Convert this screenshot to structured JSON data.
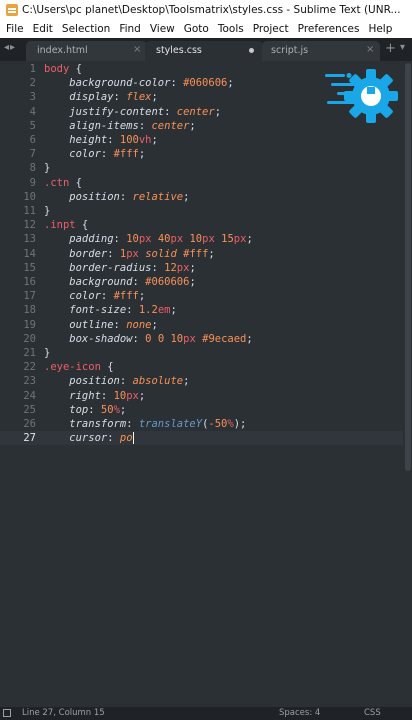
{
  "window": {
    "title": "C:\\Users\\pc planet\\Desktop\\Toolsmatrix\\styles.css - Sublime Text (UNR..."
  },
  "menu": [
    "File",
    "Edit",
    "Selection",
    "Find",
    "View",
    "Goto",
    "Tools",
    "Project",
    "Preferences",
    "Help"
  ],
  "tabs": [
    {
      "label": "index.html",
      "active": false
    },
    {
      "label": "styles.css",
      "active": true,
      "modified": true
    },
    {
      "label": "script.js",
      "active": false
    }
  ],
  "tab_nav_icons": [
    "chevron-left-icon",
    "chevron-right-icon"
  ],
  "editor": {
    "current_line": 27,
    "lines": [
      [
        [
          "body",
          "t-sel"
        ],
        [
          " {",
          "t-punc"
        ]
      ],
      [
        [
          "    background-color",
          "t-prop"
        ],
        [
          ": ",
          "t-punc"
        ],
        [
          "#060606",
          "t-val"
        ],
        [
          ";",
          "t-punc"
        ]
      ],
      [
        [
          "    display",
          "t-prop"
        ],
        [
          ": ",
          "t-punc"
        ],
        [
          "flex",
          "t-kw"
        ],
        [
          ";",
          "t-punc"
        ]
      ],
      [
        [
          "    justify-content",
          "t-prop"
        ],
        [
          ": ",
          "t-punc"
        ],
        [
          "center",
          "t-kw"
        ],
        [
          ";",
          "t-punc"
        ]
      ],
      [
        [
          "    align-items",
          "t-prop"
        ],
        [
          ": ",
          "t-punc"
        ],
        [
          "center",
          "t-kw"
        ],
        [
          ";",
          "t-punc"
        ]
      ],
      [
        [
          "    height",
          "t-prop"
        ],
        [
          ": ",
          "t-punc"
        ],
        [
          "100",
          "t-val"
        ],
        [
          "vh",
          "t-unit"
        ],
        [
          ";",
          "t-punc"
        ]
      ],
      [
        [
          "    color",
          "t-prop"
        ],
        [
          ": ",
          "t-punc"
        ],
        [
          "#fff",
          "t-val"
        ],
        [
          ";",
          "t-punc"
        ]
      ],
      [
        [
          "}",
          "t-punc"
        ]
      ],
      [
        [
          ".ctn",
          "t-sel"
        ],
        [
          " {",
          "t-punc"
        ]
      ],
      [
        [
          "    position",
          "t-prop"
        ],
        [
          ": ",
          "t-punc"
        ],
        [
          "relative",
          "t-kw"
        ],
        [
          ";",
          "t-punc"
        ]
      ],
      [
        [
          "}",
          "t-punc"
        ]
      ],
      [
        [
          ".inpt",
          "t-sel"
        ],
        [
          " {",
          "t-punc"
        ]
      ],
      [
        [
          "    padding",
          "t-prop"
        ],
        [
          ": ",
          "t-punc"
        ],
        [
          "10",
          "t-val"
        ],
        [
          "px",
          "t-unit"
        ],
        [
          " ",
          "t-text"
        ],
        [
          "40",
          "t-val"
        ],
        [
          "px",
          "t-unit"
        ],
        [
          " ",
          "t-text"
        ],
        [
          "10",
          "t-val"
        ],
        [
          "px",
          "t-unit"
        ],
        [
          " ",
          "t-text"
        ],
        [
          "15",
          "t-val"
        ],
        [
          "px",
          "t-unit"
        ],
        [
          ";",
          "t-punc"
        ]
      ],
      [
        [
          "    border",
          "t-prop"
        ],
        [
          ": ",
          "t-punc"
        ],
        [
          "1",
          "t-val"
        ],
        [
          "px",
          "t-unit"
        ],
        [
          " ",
          "t-text"
        ],
        [
          "solid",
          "t-kw"
        ],
        [
          " ",
          "t-text"
        ],
        [
          "#fff",
          "t-val"
        ],
        [
          ";",
          "t-punc"
        ]
      ],
      [
        [
          "    border-radius",
          "t-prop"
        ],
        [
          ": ",
          "t-punc"
        ],
        [
          "12",
          "t-val"
        ],
        [
          "px",
          "t-unit"
        ],
        [
          ";",
          "t-punc"
        ]
      ],
      [
        [
          "    background",
          "t-prop"
        ],
        [
          ": ",
          "t-punc"
        ],
        [
          "#060606",
          "t-val"
        ],
        [
          ";",
          "t-punc"
        ]
      ],
      [
        [
          "    color",
          "t-prop"
        ],
        [
          ": ",
          "t-punc"
        ],
        [
          "#fff",
          "t-val"
        ],
        [
          ";",
          "t-punc"
        ]
      ],
      [
        [
          "    font-size",
          "t-prop"
        ],
        [
          ": ",
          "t-punc"
        ],
        [
          "1.2",
          "t-val"
        ],
        [
          "em",
          "t-unit"
        ],
        [
          ";",
          "t-punc"
        ]
      ],
      [
        [
          "    outline",
          "t-prop"
        ],
        [
          ": ",
          "t-punc"
        ],
        [
          "none",
          "t-kw"
        ],
        [
          ";",
          "t-punc"
        ]
      ],
      [
        [
          "    box-shadow",
          "t-prop"
        ],
        [
          ": ",
          "t-punc"
        ],
        [
          "0",
          "t-val"
        ],
        [
          " ",
          "t-text"
        ],
        [
          "0",
          "t-val"
        ],
        [
          " ",
          "t-text"
        ],
        [
          "10",
          "t-val"
        ],
        [
          "px",
          "t-unit"
        ],
        [
          " ",
          "t-text"
        ],
        [
          "#9ecaed",
          "t-val"
        ],
        [
          ";",
          "t-punc"
        ]
      ],
      [
        [
          "}",
          "t-punc"
        ]
      ],
      [
        [
          ".eye-icon",
          "t-sel"
        ],
        [
          " {",
          "t-punc"
        ]
      ],
      [
        [
          "    position",
          "t-prop"
        ],
        [
          ": ",
          "t-punc"
        ],
        [
          "absolute",
          "t-kw"
        ],
        [
          ";",
          "t-punc"
        ]
      ],
      [
        [
          "    right",
          "t-prop"
        ],
        [
          ": ",
          "t-punc"
        ],
        [
          "10",
          "t-val"
        ],
        [
          "px",
          "t-unit"
        ],
        [
          ";",
          "t-punc"
        ]
      ],
      [
        [
          "    top",
          "t-prop"
        ],
        [
          ": ",
          "t-punc"
        ],
        [
          "50",
          "t-val"
        ],
        [
          "%",
          "t-unit"
        ],
        [
          ";",
          "t-punc"
        ]
      ],
      [
        [
          "    transform",
          "t-prop"
        ],
        [
          ": ",
          "t-punc"
        ],
        [
          "translateY",
          "t-func"
        ],
        [
          "(",
          "t-punc"
        ],
        [
          "-50",
          "t-val"
        ],
        [
          "%",
          "t-unit"
        ],
        [
          ");",
          "t-punc"
        ]
      ],
      [
        [
          "    cursor",
          "t-prop"
        ],
        [
          ": ",
          "t-punc"
        ],
        [
          "po",
          "t-kw"
        ]
      ]
    ]
  },
  "status": {
    "position": "Line 27, Column 15",
    "spaces": "Spaces: 4",
    "syntax": "CSS"
  },
  "colors": {
    "editor_bg": "#2b3035",
    "tabbar_bg": "#1f2326",
    "logo_accent": "#1aa7e8"
  }
}
